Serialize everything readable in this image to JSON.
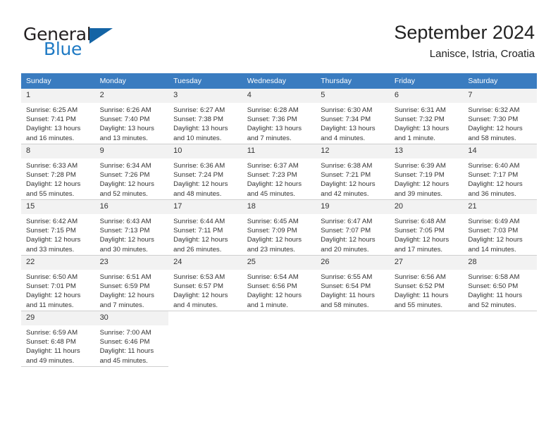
{
  "logo": {
    "word1": "General",
    "word2": "Blue",
    "triangle_color": "#1464a5",
    "blue_color": "#1f7ac4",
    "dark_color": "#231f20"
  },
  "header": {
    "month_title": "September 2024",
    "location": "Lanisce, Istria, Croatia"
  },
  "theme": {
    "header_row_bg": "#3a7cc0",
    "daynum_bg": "#f2f2f2",
    "grid_line": "#cfcfcf",
    "text": "#333333"
  },
  "weekday_headers": [
    "Sunday",
    "Monday",
    "Tuesday",
    "Wednesday",
    "Thursday",
    "Friday",
    "Saturday"
  ],
  "weeks": [
    [
      {
        "day": "1",
        "sunrise": "Sunrise: 6:25 AM",
        "sunset": "Sunset: 7:41 PM",
        "daylight1": "Daylight: 13 hours",
        "daylight2": "and 16 minutes."
      },
      {
        "day": "2",
        "sunrise": "Sunrise: 6:26 AM",
        "sunset": "Sunset: 7:40 PM",
        "daylight1": "Daylight: 13 hours",
        "daylight2": "and 13 minutes."
      },
      {
        "day": "3",
        "sunrise": "Sunrise: 6:27 AM",
        "sunset": "Sunset: 7:38 PM",
        "daylight1": "Daylight: 13 hours",
        "daylight2": "and 10 minutes."
      },
      {
        "day": "4",
        "sunrise": "Sunrise: 6:28 AM",
        "sunset": "Sunset: 7:36 PM",
        "daylight1": "Daylight: 13 hours",
        "daylight2": "and 7 minutes."
      },
      {
        "day": "5",
        "sunrise": "Sunrise: 6:30 AM",
        "sunset": "Sunset: 7:34 PM",
        "daylight1": "Daylight: 13 hours",
        "daylight2": "and 4 minutes."
      },
      {
        "day": "6",
        "sunrise": "Sunrise: 6:31 AM",
        "sunset": "Sunset: 7:32 PM",
        "daylight1": "Daylight: 13 hours",
        "daylight2": "and 1 minute."
      },
      {
        "day": "7",
        "sunrise": "Sunrise: 6:32 AM",
        "sunset": "Sunset: 7:30 PM",
        "daylight1": "Daylight: 12 hours",
        "daylight2": "and 58 minutes."
      }
    ],
    [
      {
        "day": "8",
        "sunrise": "Sunrise: 6:33 AM",
        "sunset": "Sunset: 7:28 PM",
        "daylight1": "Daylight: 12 hours",
        "daylight2": "and 55 minutes."
      },
      {
        "day": "9",
        "sunrise": "Sunrise: 6:34 AM",
        "sunset": "Sunset: 7:26 PM",
        "daylight1": "Daylight: 12 hours",
        "daylight2": "and 52 minutes."
      },
      {
        "day": "10",
        "sunrise": "Sunrise: 6:36 AM",
        "sunset": "Sunset: 7:24 PM",
        "daylight1": "Daylight: 12 hours",
        "daylight2": "and 48 minutes."
      },
      {
        "day": "11",
        "sunrise": "Sunrise: 6:37 AM",
        "sunset": "Sunset: 7:23 PM",
        "daylight1": "Daylight: 12 hours",
        "daylight2": "and 45 minutes."
      },
      {
        "day": "12",
        "sunrise": "Sunrise: 6:38 AM",
        "sunset": "Sunset: 7:21 PM",
        "daylight1": "Daylight: 12 hours",
        "daylight2": "and 42 minutes."
      },
      {
        "day": "13",
        "sunrise": "Sunrise: 6:39 AM",
        "sunset": "Sunset: 7:19 PM",
        "daylight1": "Daylight: 12 hours",
        "daylight2": "and 39 minutes."
      },
      {
        "day": "14",
        "sunrise": "Sunrise: 6:40 AM",
        "sunset": "Sunset: 7:17 PM",
        "daylight1": "Daylight: 12 hours",
        "daylight2": "and 36 minutes."
      }
    ],
    [
      {
        "day": "15",
        "sunrise": "Sunrise: 6:42 AM",
        "sunset": "Sunset: 7:15 PM",
        "daylight1": "Daylight: 12 hours",
        "daylight2": "and 33 minutes."
      },
      {
        "day": "16",
        "sunrise": "Sunrise: 6:43 AM",
        "sunset": "Sunset: 7:13 PM",
        "daylight1": "Daylight: 12 hours",
        "daylight2": "and 30 minutes."
      },
      {
        "day": "17",
        "sunrise": "Sunrise: 6:44 AM",
        "sunset": "Sunset: 7:11 PM",
        "daylight1": "Daylight: 12 hours",
        "daylight2": "and 26 minutes."
      },
      {
        "day": "18",
        "sunrise": "Sunrise: 6:45 AM",
        "sunset": "Sunset: 7:09 PM",
        "daylight1": "Daylight: 12 hours",
        "daylight2": "and 23 minutes."
      },
      {
        "day": "19",
        "sunrise": "Sunrise: 6:47 AM",
        "sunset": "Sunset: 7:07 PM",
        "daylight1": "Daylight: 12 hours",
        "daylight2": "and 20 minutes."
      },
      {
        "day": "20",
        "sunrise": "Sunrise: 6:48 AM",
        "sunset": "Sunset: 7:05 PM",
        "daylight1": "Daylight: 12 hours",
        "daylight2": "and 17 minutes."
      },
      {
        "day": "21",
        "sunrise": "Sunrise: 6:49 AM",
        "sunset": "Sunset: 7:03 PM",
        "daylight1": "Daylight: 12 hours",
        "daylight2": "and 14 minutes."
      }
    ],
    [
      {
        "day": "22",
        "sunrise": "Sunrise: 6:50 AM",
        "sunset": "Sunset: 7:01 PM",
        "daylight1": "Daylight: 12 hours",
        "daylight2": "and 11 minutes."
      },
      {
        "day": "23",
        "sunrise": "Sunrise: 6:51 AM",
        "sunset": "Sunset: 6:59 PM",
        "daylight1": "Daylight: 12 hours",
        "daylight2": "and 7 minutes."
      },
      {
        "day": "24",
        "sunrise": "Sunrise: 6:53 AM",
        "sunset": "Sunset: 6:57 PM",
        "daylight1": "Daylight: 12 hours",
        "daylight2": "and 4 minutes."
      },
      {
        "day": "25",
        "sunrise": "Sunrise: 6:54 AM",
        "sunset": "Sunset: 6:56 PM",
        "daylight1": "Daylight: 12 hours",
        "daylight2": "and 1 minute."
      },
      {
        "day": "26",
        "sunrise": "Sunrise: 6:55 AM",
        "sunset": "Sunset: 6:54 PM",
        "daylight1": "Daylight: 11 hours",
        "daylight2": "and 58 minutes."
      },
      {
        "day": "27",
        "sunrise": "Sunrise: 6:56 AM",
        "sunset": "Sunset: 6:52 PM",
        "daylight1": "Daylight: 11 hours",
        "daylight2": "and 55 minutes."
      },
      {
        "day": "28",
        "sunrise": "Sunrise: 6:58 AM",
        "sunset": "Sunset: 6:50 PM",
        "daylight1": "Daylight: 11 hours",
        "daylight2": "and 52 minutes."
      }
    ],
    [
      {
        "day": "29",
        "sunrise": "Sunrise: 6:59 AM",
        "sunset": "Sunset: 6:48 PM",
        "daylight1": "Daylight: 11 hours",
        "daylight2": "and 49 minutes."
      },
      {
        "day": "30",
        "sunrise": "Sunrise: 7:00 AM",
        "sunset": "Sunset: 6:46 PM",
        "daylight1": "Daylight: 11 hours",
        "daylight2": "and 45 minutes."
      },
      {
        "day": "",
        "sunrise": "",
        "sunset": "",
        "daylight1": "",
        "daylight2": ""
      },
      {
        "day": "",
        "sunrise": "",
        "sunset": "",
        "daylight1": "",
        "daylight2": ""
      },
      {
        "day": "",
        "sunrise": "",
        "sunset": "",
        "daylight1": "",
        "daylight2": ""
      },
      {
        "day": "",
        "sunrise": "",
        "sunset": "",
        "daylight1": "",
        "daylight2": ""
      },
      {
        "day": "",
        "sunrise": "",
        "sunset": "",
        "daylight1": "",
        "daylight2": ""
      }
    ]
  ]
}
